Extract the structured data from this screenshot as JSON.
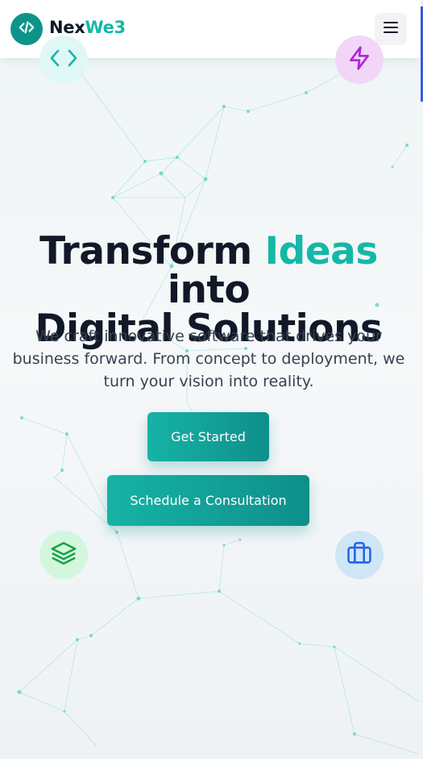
{
  "header": {
    "brand_part1": "Nex",
    "brand_part2": "We3",
    "logo_icon": "code-slash-icon",
    "menu_icon": "hamburger-menu-icon"
  },
  "hero": {
    "title_line1_before": "Transform ",
    "title_highlight": "Ideas",
    "title_line1_after": " into",
    "title_line2": "Digital Solutions",
    "subtitle": "We craft innovative software that drives your business forward. From concept to deployment, we turn your vision into reality.",
    "primary_button": "Get Started",
    "secondary_button": "Schedule a Consultation"
  },
  "floating_icons": [
    "code-icon",
    "lightning-bolt-icon",
    "layers-icon",
    "briefcase-icon"
  ],
  "colors": {
    "accent": "#14b8a6",
    "accent_dark": "#0d9488",
    "text": "#111827",
    "bolt": "#b026d6"
  }
}
